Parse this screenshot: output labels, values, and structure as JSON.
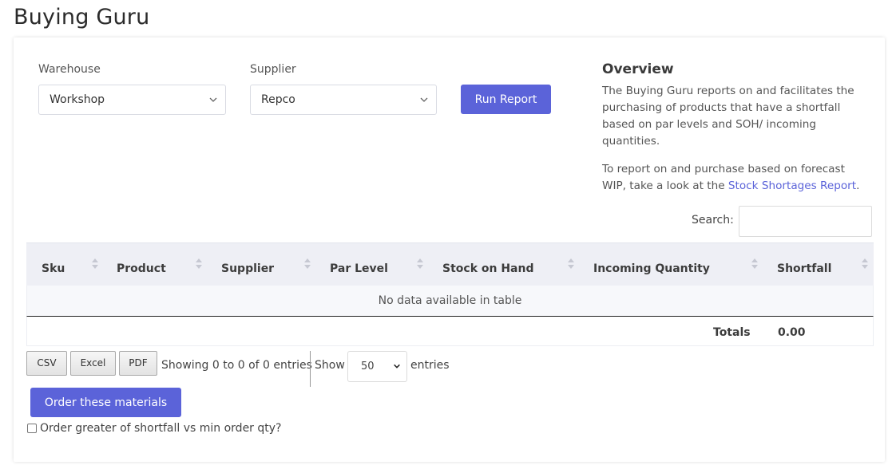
{
  "page": {
    "title": "Buying Guru"
  },
  "filters": {
    "warehouse_label": "Warehouse",
    "warehouse_value": "Workshop",
    "supplier_label": "Supplier",
    "supplier_value": "Repco",
    "run_button": "Run Report"
  },
  "overview": {
    "title": "Overview",
    "paragraph1": "The Buying Guru reports on and facilitates the purchasing of products that have a shortfall based on par levels and SOH/ incoming quantities.",
    "paragraph2_prefix": "To report on and purchase based on forecast WIP, take a look at the ",
    "paragraph2_link": "Stock Shortages Report",
    "paragraph2_suffix": "."
  },
  "search": {
    "label": "Search:",
    "value": ""
  },
  "table": {
    "columns": [
      "Sku",
      "Product",
      "Supplier",
      "Par Level",
      "Stock on Hand",
      "Incoming Quantity",
      "Shortfall"
    ],
    "empty_message": "No data available in table",
    "footer_label": "Totals",
    "footer_value": "0.00"
  },
  "exports": {
    "csv": "CSV",
    "excel": "Excel",
    "pdf": "PDF"
  },
  "pagination": {
    "info": "Showing 0 to 0 of 0 entries",
    "show_label": "Show",
    "page_length": "50",
    "entries_label": "entries"
  },
  "order": {
    "button": "Order these materials",
    "checkbox_label": "Order greater of shortfall vs min order qty?",
    "checkbox_checked": false
  },
  "colors": {
    "accent": "#5b63d9",
    "header_bg": "#eeeff5"
  }
}
